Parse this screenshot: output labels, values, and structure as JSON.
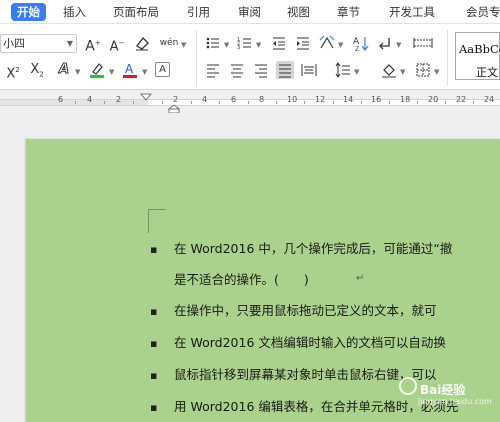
{
  "tabs": [
    "开始",
    "插入",
    "页面布局",
    "引用",
    "审阅",
    "视图",
    "章节",
    "开发工具",
    "会员专"
  ],
  "ribbon": {
    "font_size_value": "小四",
    "style_gallery_line1": "AaBbCcDd",
    "style_gallery_line2": "正文"
  },
  "ruler": {
    "numbers": [
      "6",
      "4",
      "2",
      "2",
      "4",
      "6",
      "8",
      "10",
      "12",
      "14",
      "16",
      "18",
      "20",
      "22",
      "24"
    ]
  },
  "document": {
    "paragraphs": [
      "在 Word2016 中，几个操作完成后，可能通过“撤",
      "是不适合的操作。(　　)",
      "在操作中，只要用鼠标拖动已定义的文本，就可",
      "在 Word2016 文档编辑时输入的文档可以自动换",
      "鼠标指针移到屏幕某对象时单击鼠标右键，可以",
      "用 Word2016 编辑表格，在合并单元格时，必须先"
    ]
  },
  "watermark": {
    "text": "Bai经验",
    "url": "jingyan.baidu.com"
  },
  "colors": {
    "page_bg": "#aad28c",
    "accent": "#3d7bf5",
    "font_color_red": "#e02020",
    "highlight_green": "#22cc22",
    "font_color_blue": "#2255dd"
  }
}
